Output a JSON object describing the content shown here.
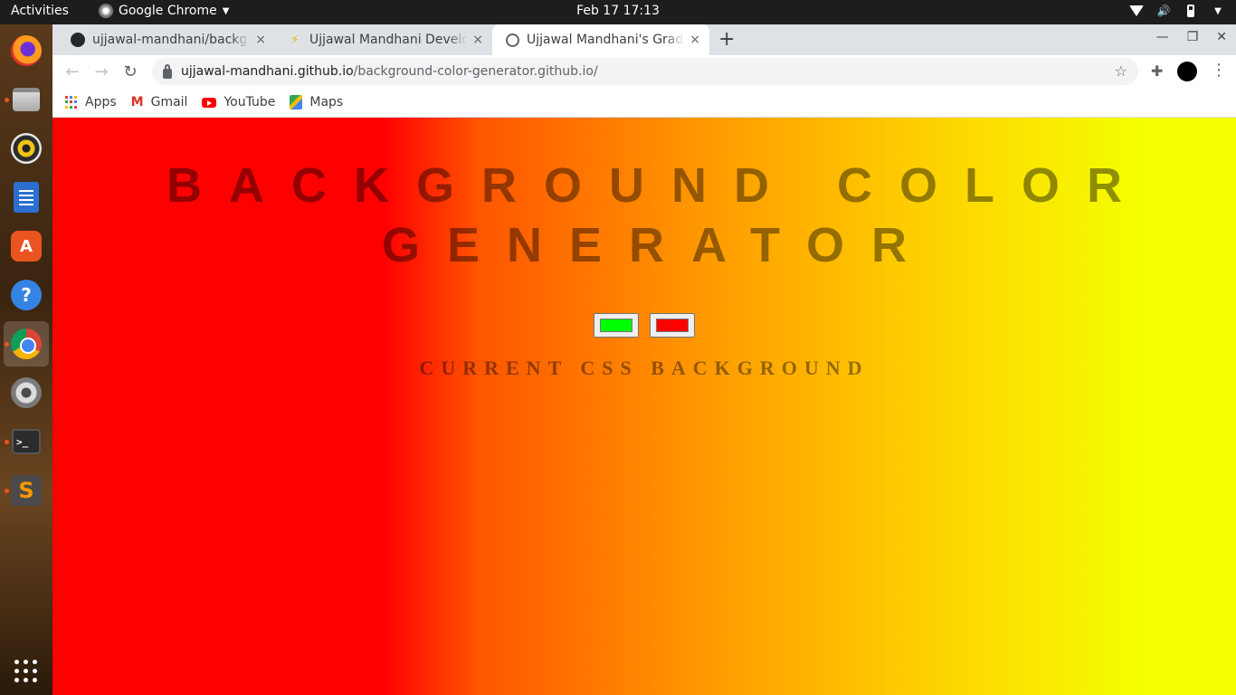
{
  "topbar": {
    "activities": "Activities",
    "app_name": "Google Chrome",
    "clock": "Feb 17  17:13"
  },
  "dock": {
    "items": [
      "firefox",
      "files",
      "rhythmbox",
      "libreoffice-writer",
      "ubuntu-software",
      "help",
      "google-chrome",
      "settings",
      "terminal",
      "sublime-text"
    ]
  },
  "tabs": [
    {
      "title": "ujjawal-mandhani/background-color-generator",
      "icon": "github-icon",
      "close": "×"
    },
    {
      "title": "Ujjawal Mandhani Developer",
      "icon": "lightning-icon",
      "close": "×"
    },
    {
      "title": "Ujjawal Mandhani's Gradient",
      "icon": "globe-icon",
      "close": "×"
    }
  ],
  "toolbar": {
    "url_host": "ujjawal-mandhani.github.io",
    "url_path": "/background-color-generator.github.io/"
  },
  "bookmarks": [
    {
      "label": "Apps",
      "icon": "apps-icon"
    },
    {
      "label": "Gmail",
      "icon": "gmail-icon"
    },
    {
      "label": "YouTube",
      "icon": "youtube-icon"
    },
    {
      "label": "Maps",
      "icon": "maps-icon"
    }
  ],
  "page": {
    "heading": "BACKGROUND COLOR GENERATOR",
    "color1": "#00ff00",
    "color2": "#ff0000",
    "current_label": "CURRENT CSS BACKGROUND",
    "gradient_colors": [
      "#ff0000",
      "#f5ff00"
    ]
  }
}
